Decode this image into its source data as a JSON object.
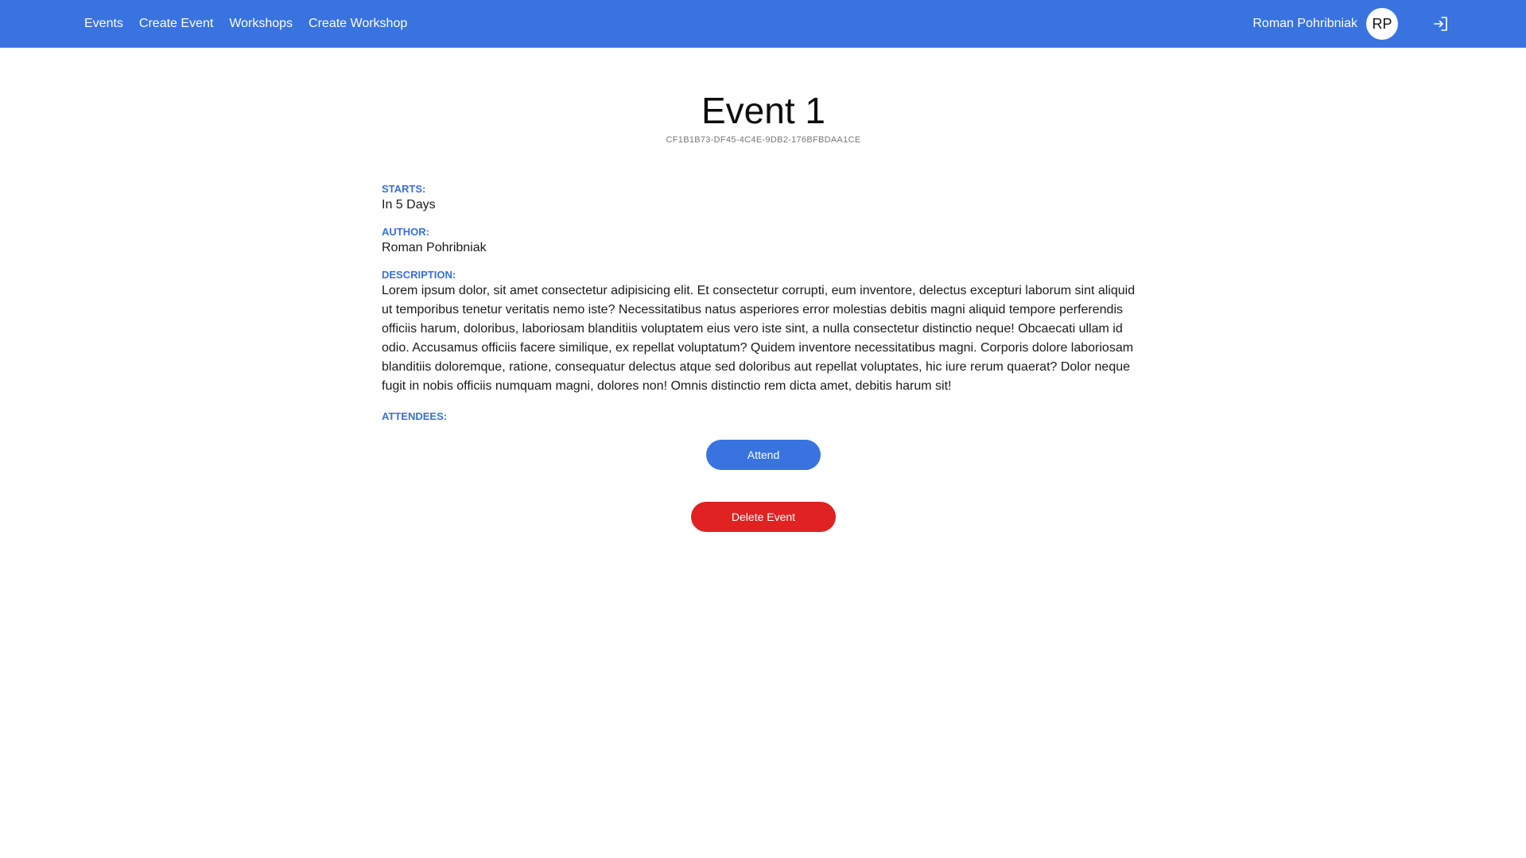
{
  "nav": {
    "links": [
      "Events",
      "Create Event",
      "Workshops",
      "Create Workshop"
    ],
    "user_name": "Roman Pohribniak",
    "avatar_initials": "RP",
    "logout_icon": "logout-icon"
  },
  "event": {
    "title": "Event 1",
    "id": "CF1B1B73-DF45-4C4E-9DB2-176BFBDAA1CE",
    "starts_label": "STARTS:",
    "starts_value": "In 5 Days",
    "author_label": "AUTHOR:",
    "author_value": "Roman Pohribniak",
    "description_label": "DESCRIPTION:",
    "description_value": "Lorem ipsum dolor, sit amet consectetur adipisicing elit. Et consectetur corrupti, eum inventore, delectus excepturi laborum sint aliquid ut temporibus tenetur veritatis nemo iste? Necessitatibus natus asperiores error molestias debitis magni aliquid tempore perferendis officiis harum, doloribus, laboriosam blanditiis voluptatem eius vero iste sint, a nulla consectetur distinctio neque! Obcaecati ullam id odio. Accusamus officiis facere similique, ex repellat voluptatum? Quidem inventore necessitatibus magni. Corporis dolore laboriosam blanditiis doloremque, ratione, consequatur delectus atque sed doloribus aut repellat voluptates, hic iure rerum quaerat? Dolor neque fugit in nobis officiis numquam magni, dolores non! Omnis distinctio rem dicta amet, debitis harum sit!",
    "attendees_label": "ATTENDEES:"
  },
  "actions": {
    "attend_label": "Attend",
    "delete_label": "Delete Event"
  },
  "colors": {
    "primary": "#3873e0",
    "danger": "#e02222",
    "label": "#3a6fd8"
  }
}
